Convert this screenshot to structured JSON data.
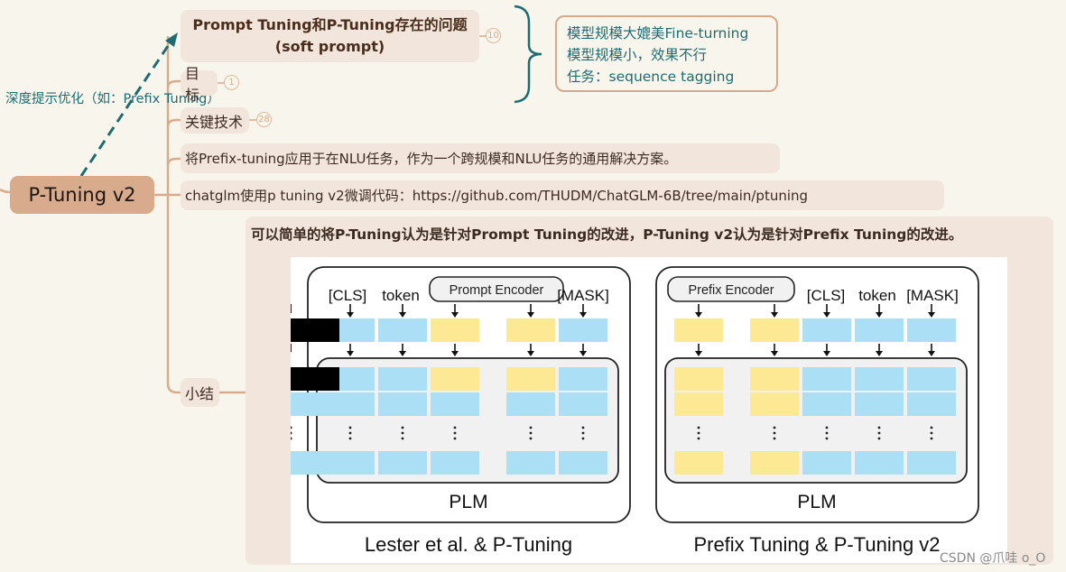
{
  "root": {
    "label": "P-Tuning v2"
  },
  "relation": {
    "label": "深度提示优化（如：Prefix Tuning）"
  },
  "topics": [
    {
      "id": "problems",
      "title_line1": "Prompt Tuning和P-Tuning存在的问题",
      "title_line2": "(soft prompt)",
      "badge": "10"
    },
    {
      "id": "goal",
      "title": "目标",
      "badge": "1"
    },
    {
      "id": "key-tech",
      "title": "关键技术",
      "badge": "28"
    },
    {
      "id": "apply",
      "title": "将Prefix-tuning应用于在NLU任务，作为一个跨规模和NLU任务的通用解决方案。"
    },
    {
      "id": "code",
      "title": "chatglm使用p tuning v2微调代码：https://github.com/THUDM/ChatGLM-6B/tree/main/ptuning"
    },
    {
      "id": "summary",
      "title": "小结"
    }
  ],
  "callout": {
    "lines": [
      "模型规模大媲美Fine-turning",
      "模型规模小，效果不行",
      "任务：sequence tagging"
    ]
  },
  "summary": {
    "text": "可以简单的将P-Tuning认为是针对Prompt Tuning的改进，P-Tuning v2认为是针对Prefix Tuning的改进。",
    "figure": {
      "left": {
        "encoder": "Prompt Encoder",
        "tokens": [
          "[CLS]",
          "token",
          "[MASK]"
        ],
        "model": "PLM",
        "caption": "Lester et al. & P-Tuning"
      },
      "right": {
        "encoder": "Prefix Encoder",
        "tokens": [
          "[CLS]",
          "token",
          "[MASK]"
        ],
        "model": "PLM",
        "caption": "Prefix Tuning & P-Tuning v2"
      },
      "ellipsis": "...",
      "colors": {
        "blue": "#abdff5",
        "yellow": "#fde893"
      }
    }
  },
  "watermark": "CSDN @爪哇 o_O",
  "colors": {
    "accent": "#1e6b72",
    "branch": "#d8ab8d",
    "node_bg": "#f2e6dc",
    "background": "#f8f6ec"
  }
}
